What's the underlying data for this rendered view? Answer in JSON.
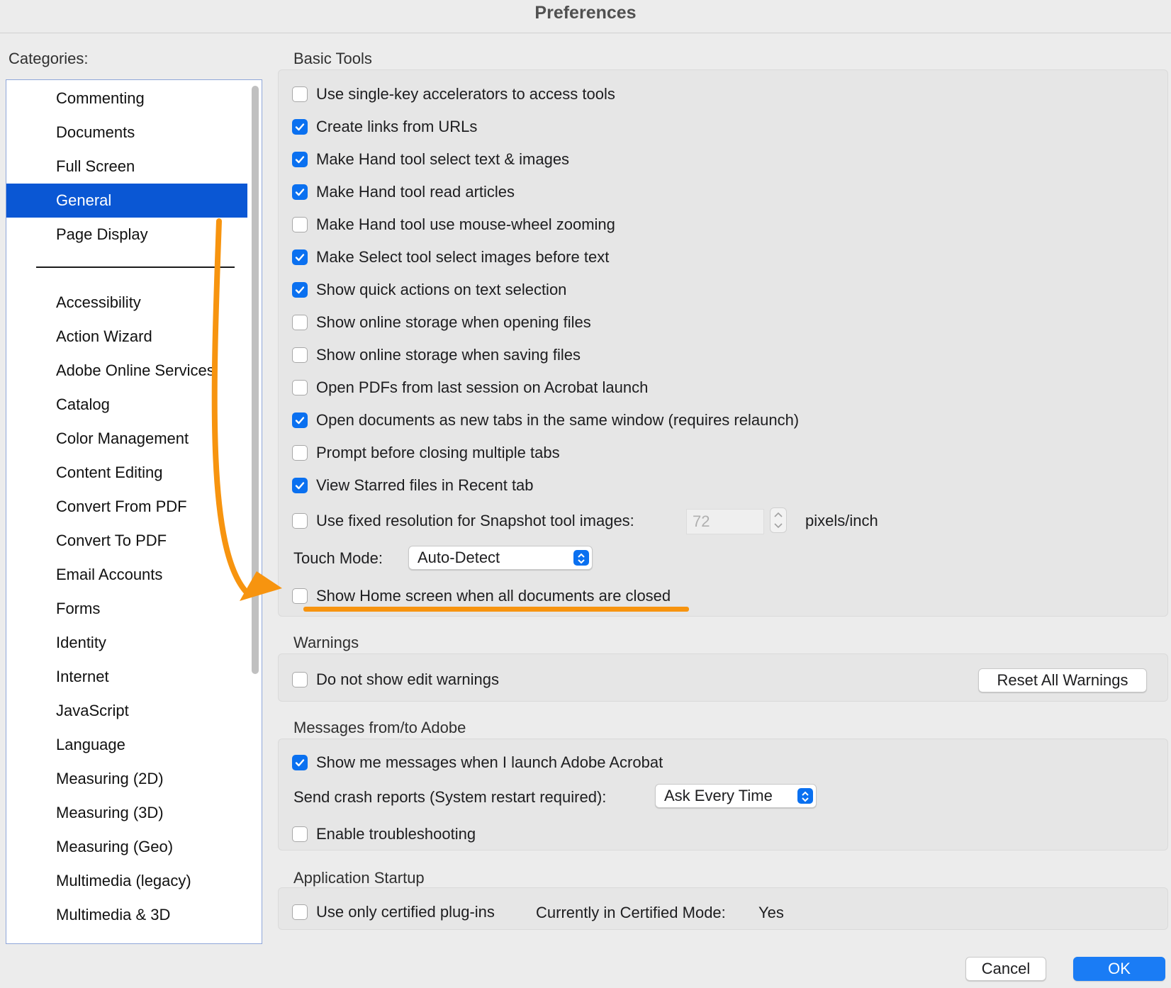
{
  "window": {
    "title": "Preferences"
  },
  "categories": {
    "label": "Categories:",
    "items_top": [
      "Commenting",
      "Documents",
      "Full Screen",
      "General",
      "Page Display"
    ],
    "selected": "General",
    "items_bottom": [
      "Accessibility",
      "Action Wizard",
      "Adobe Online Services",
      "Catalog",
      "Color Management",
      "Content Editing",
      "Convert From PDF",
      "Convert To PDF",
      "Email Accounts",
      "Forms",
      "Identity",
      "Internet",
      "JavaScript",
      "Language",
      "Measuring (2D)",
      "Measuring (3D)",
      "Measuring (Geo)",
      "Multimedia (legacy)",
      "Multimedia & 3D"
    ]
  },
  "basic_tools": {
    "title": "Basic Tools",
    "options": [
      {
        "label": "Use single-key accelerators to access tools",
        "checked": false
      },
      {
        "label": "Create links from URLs",
        "checked": true
      },
      {
        "label": "Make Hand tool select text & images",
        "checked": true
      },
      {
        "label": "Make Hand tool read articles",
        "checked": true
      },
      {
        "label": "Make Hand tool use mouse-wheel zooming",
        "checked": false
      },
      {
        "label": "Make Select tool select images before text",
        "checked": true
      },
      {
        "label": "Show quick actions on text selection",
        "checked": true
      },
      {
        "label": "Show online storage when opening files",
        "checked": false
      },
      {
        "label": "Show online storage when saving files",
        "checked": false
      },
      {
        "label": "Open PDFs from last session on Acrobat launch",
        "checked": false
      },
      {
        "label": "Open documents as new tabs in the same window (requires relaunch)",
        "checked": true
      },
      {
        "label": "Prompt before closing multiple tabs",
        "checked": false
      },
      {
        "label": "View Starred files in Recent tab",
        "checked": true
      }
    ],
    "snapshot": {
      "label": "Use fixed resolution for Snapshot tool images:",
      "checked": false,
      "value": "72",
      "unit": "pixels/inch"
    },
    "touch_mode": {
      "label": "Touch Mode:",
      "value": "Auto-Detect"
    },
    "home_screen": {
      "label": "Show Home screen when all documents are closed",
      "checked": false
    }
  },
  "warnings": {
    "title": "Warnings",
    "option": {
      "label": "Do not show edit warnings",
      "checked": false
    },
    "reset_button": "Reset All Warnings"
  },
  "messages": {
    "title": "Messages from/to Adobe",
    "show_messages": {
      "label": "Show me messages when I launch Adobe Acrobat",
      "checked": true
    },
    "crash_reports": {
      "label": "Send crash reports (System restart required):",
      "value": "Ask Every Time"
    },
    "troubleshooting": {
      "label": "Enable troubleshooting",
      "checked": false
    }
  },
  "startup": {
    "title": "Application Startup",
    "certified": {
      "label": "Use only certified plug-ins",
      "checked": false
    },
    "mode_label": "Currently in Certified Mode:",
    "mode_value": "Yes"
  },
  "buttons": {
    "cancel": "Cancel",
    "ok": "OK"
  },
  "colors": {
    "accent": "#0a70f0",
    "selection": "#0a57d4",
    "annotation": "#f7940f"
  }
}
